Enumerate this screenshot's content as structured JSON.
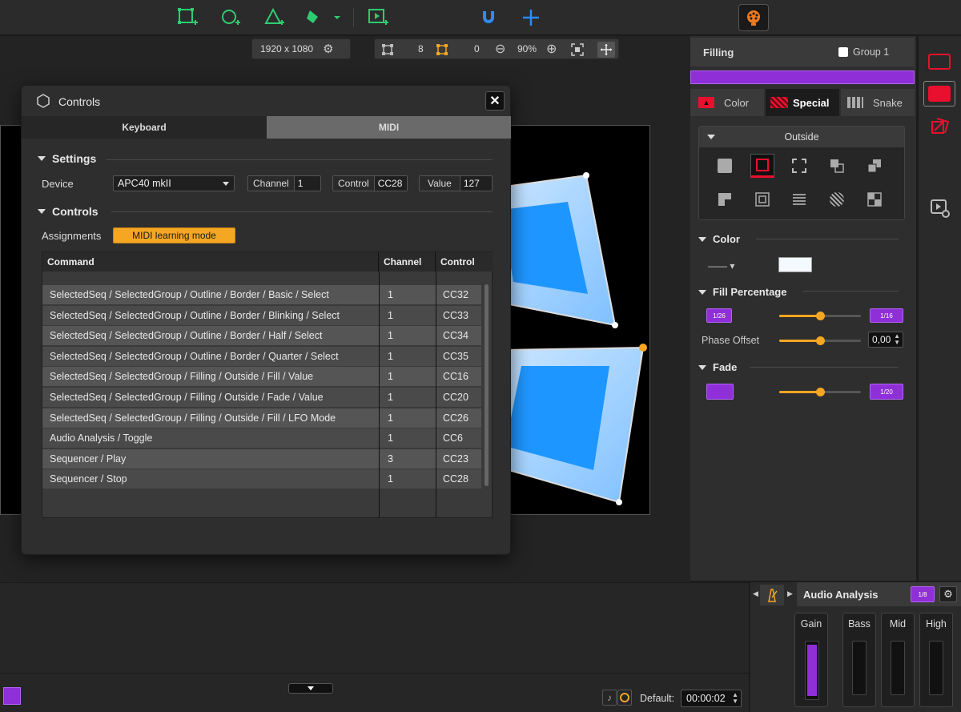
{
  "toolbar": {
    "resolution": "1920 x 1080",
    "points_count": "8",
    "selected_points": "0",
    "zoom": "90%"
  },
  "dialog": {
    "title": "Controls",
    "tabs": [
      "Keyboard",
      "MIDI"
    ],
    "active_tab": "MIDI",
    "settings_heading": "Settings",
    "device_label": "Device",
    "device_value": "APC40 mkII",
    "channel_label": "Channel",
    "channel_value": "1",
    "control_label": "Control",
    "control_value": "CC28",
    "value_label": "Value",
    "value_value": "127",
    "controls_heading": "Controls",
    "assignments_label": "Assignments",
    "learn_button": "MIDI learning mode",
    "table": {
      "headers": [
        "Command",
        "Channel",
        "Control"
      ],
      "rows": [
        {
          "command": "SelectedSeq / SelectedGroup / Outline / Border / Basic / Select",
          "channel": "1",
          "control": "CC32"
        },
        {
          "command": "SelectedSeq / SelectedGroup / Outline / Border / Blinking / Select",
          "channel": "1",
          "control": "CC33"
        },
        {
          "command": "SelectedSeq / SelectedGroup / Outline / Border / Half / Select",
          "channel": "1",
          "control": "CC34"
        },
        {
          "command": "SelectedSeq / SelectedGroup / Outline / Border / Quarter / Select",
          "channel": "1",
          "control": "CC35"
        },
        {
          "command": "SelectedSeq / SelectedGroup / Filling / Outside / Fill / Value",
          "channel": "1",
          "control": "CC16"
        },
        {
          "command": "SelectedSeq / SelectedGroup / Filling / Outside / Fade / Value",
          "channel": "1",
          "control": "CC20"
        },
        {
          "command": "SelectedSeq / SelectedGroup / Filling / Outside / Fill / LFO Mode",
          "channel": "1",
          "control": "CC26"
        },
        {
          "command": "Audio Analysis / Toggle",
          "channel": "1",
          "control": "CC6"
        },
        {
          "command": "Sequencer / Play",
          "channel": "3",
          "control": "CC23"
        },
        {
          "command": "Sequencer / Stop",
          "channel": "1",
          "control": "CC28"
        }
      ]
    }
  },
  "right_panel": {
    "title": "Filling",
    "group_label": "Group 1",
    "tabs": [
      "Color",
      "Special",
      "Snake"
    ],
    "active_tab": "Special",
    "mode_dropdown": "Outside",
    "color_heading": "Color",
    "fill_heading": "Fill Percentage",
    "fill_left_chip": "1/26",
    "fill_right_chip": "1/16",
    "fill_level": 0.5,
    "phase_label": "Phase Offset",
    "phase_value": "0,00",
    "phase_level": 0.5,
    "fade_heading": "Fade",
    "fade_right_chip": "1/20",
    "fade_level": 0.5,
    "accent": "#8e2fd8",
    "slider_color": "#f5a623"
  },
  "audio": {
    "title": "Audio Analysis",
    "chip": "1/8",
    "bands": [
      "Gain",
      "Bass",
      "Mid",
      "High"
    ]
  },
  "bottom": {
    "default_label": "Default:",
    "time_value": "00:00:02"
  }
}
